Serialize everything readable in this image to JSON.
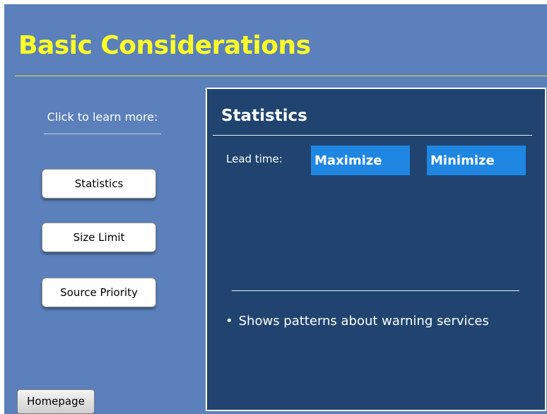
{
  "slide": {
    "title": "Basic Considerations",
    "colors": {
      "background": "#5b80bb",
      "title": "#ffff26",
      "panel": "#20446f",
      "option_button": "#1f86e2"
    }
  },
  "sidebar": {
    "prompt": "Click to learn more:",
    "buttons": [
      {
        "label": "Statistics"
      },
      {
        "label": "Size Limit"
      },
      {
        "label": "Source Priority"
      }
    ]
  },
  "panel": {
    "title": "Statistics",
    "lead_label": "Lead time:",
    "options": [
      {
        "label": "Maximize"
      },
      {
        "label": "Minimize"
      }
    ],
    "bullets": [
      {
        "marker": "•",
        "text": "Shows patterns about warning services"
      }
    ]
  },
  "footer": {
    "home_label": "Homepage"
  }
}
